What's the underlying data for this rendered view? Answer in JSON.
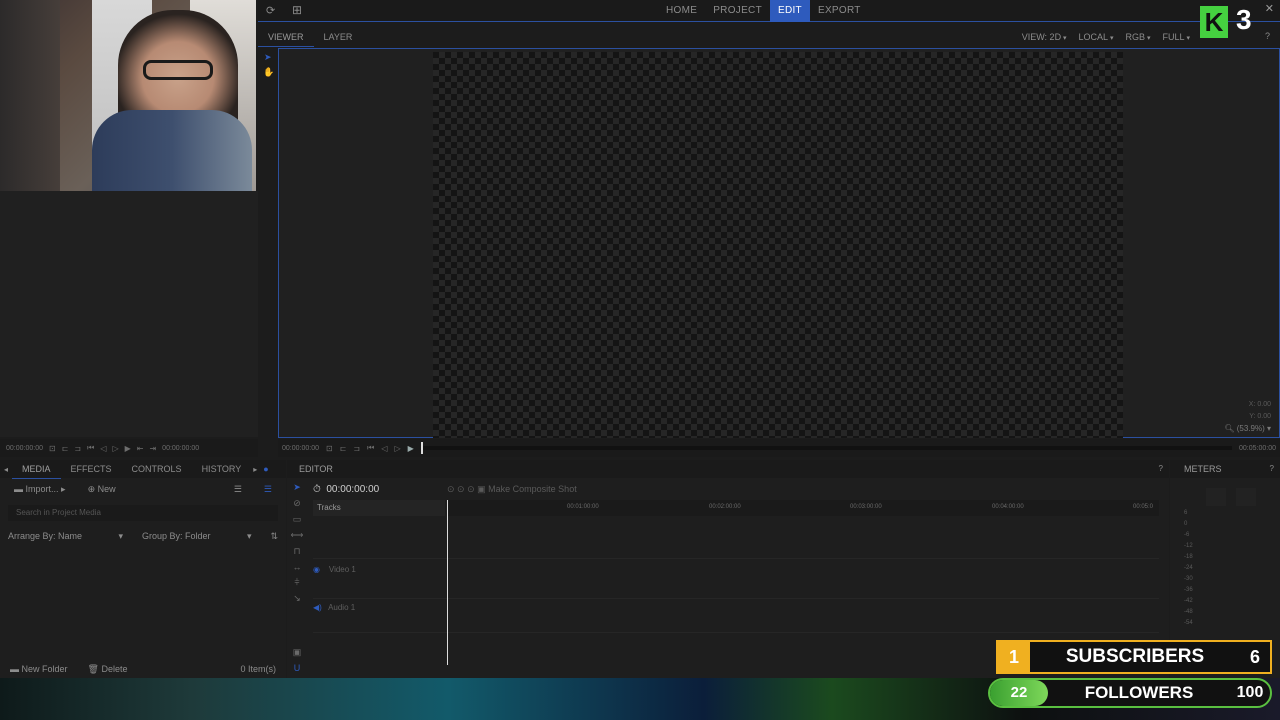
{
  "topnav": {
    "items": [
      "HOME",
      "PROJECT",
      "EDIT",
      "EXPORT"
    ],
    "active": "EDIT"
  },
  "viewer": {
    "tabs": [
      "VIEWER",
      "LAYER"
    ],
    "options": [
      "VIEW: 2D",
      "LOCAL",
      "RGB",
      "FULL"
    ],
    "x_label": "X:",
    "x_value": "0.00",
    "y_label": "Y:",
    "y_value": "0.00",
    "zoom": "(53.9%)",
    "timecode": "00:00:00:00",
    "duration": "00:05:00:00"
  },
  "source_monitor": {
    "timecode_left": "00:00:00:00",
    "timecode_right": "00:00:00:00"
  },
  "left_panel": {
    "tabs": [
      "MEDIA",
      "EFFECTS",
      "CONTROLS",
      "HISTORY"
    ],
    "import_label": "Import...",
    "new_label": "New",
    "search_placeholder": "Search in Project Media",
    "arrange_label": "Arrange By: Name",
    "group_label": "Group By: Folder",
    "new_folder_label": "New Folder",
    "delete_label": "Delete",
    "item_count": "0 Item(s)"
  },
  "editor": {
    "title": "EDITOR",
    "timecode": "00:00:00:00",
    "composite_label": "Make Composite Shot",
    "tracks_label": "Tracks",
    "video_track": "Video 1",
    "audio_track": "Audio 1",
    "ruler": [
      "00:01:00:00",
      "00:02:00:00",
      "00:03:00:00",
      "00:04:00:00",
      "00:05:0"
    ]
  },
  "meters": {
    "title": "METERS",
    "scale": [
      "6",
      "0",
      "-6",
      "-12",
      "-18",
      "-24",
      "-30",
      "-36",
      "-42",
      "-48",
      "-54"
    ]
  },
  "stream_overlay": {
    "subscribers_label": "SUBSCRIBERS",
    "subscribers_count": "1",
    "subscribers_goal": "6",
    "followers_label": "FOLLOWERS",
    "followers_count": "22",
    "followers_goal": "100",
    "logo_letter": "K",
    "logo_number": "3"
  },
  "colors": {
    "accent": "#2e5bbd",
    "subscribers": "#f0b020",
    "followers": "#5ac040"
  }
}
